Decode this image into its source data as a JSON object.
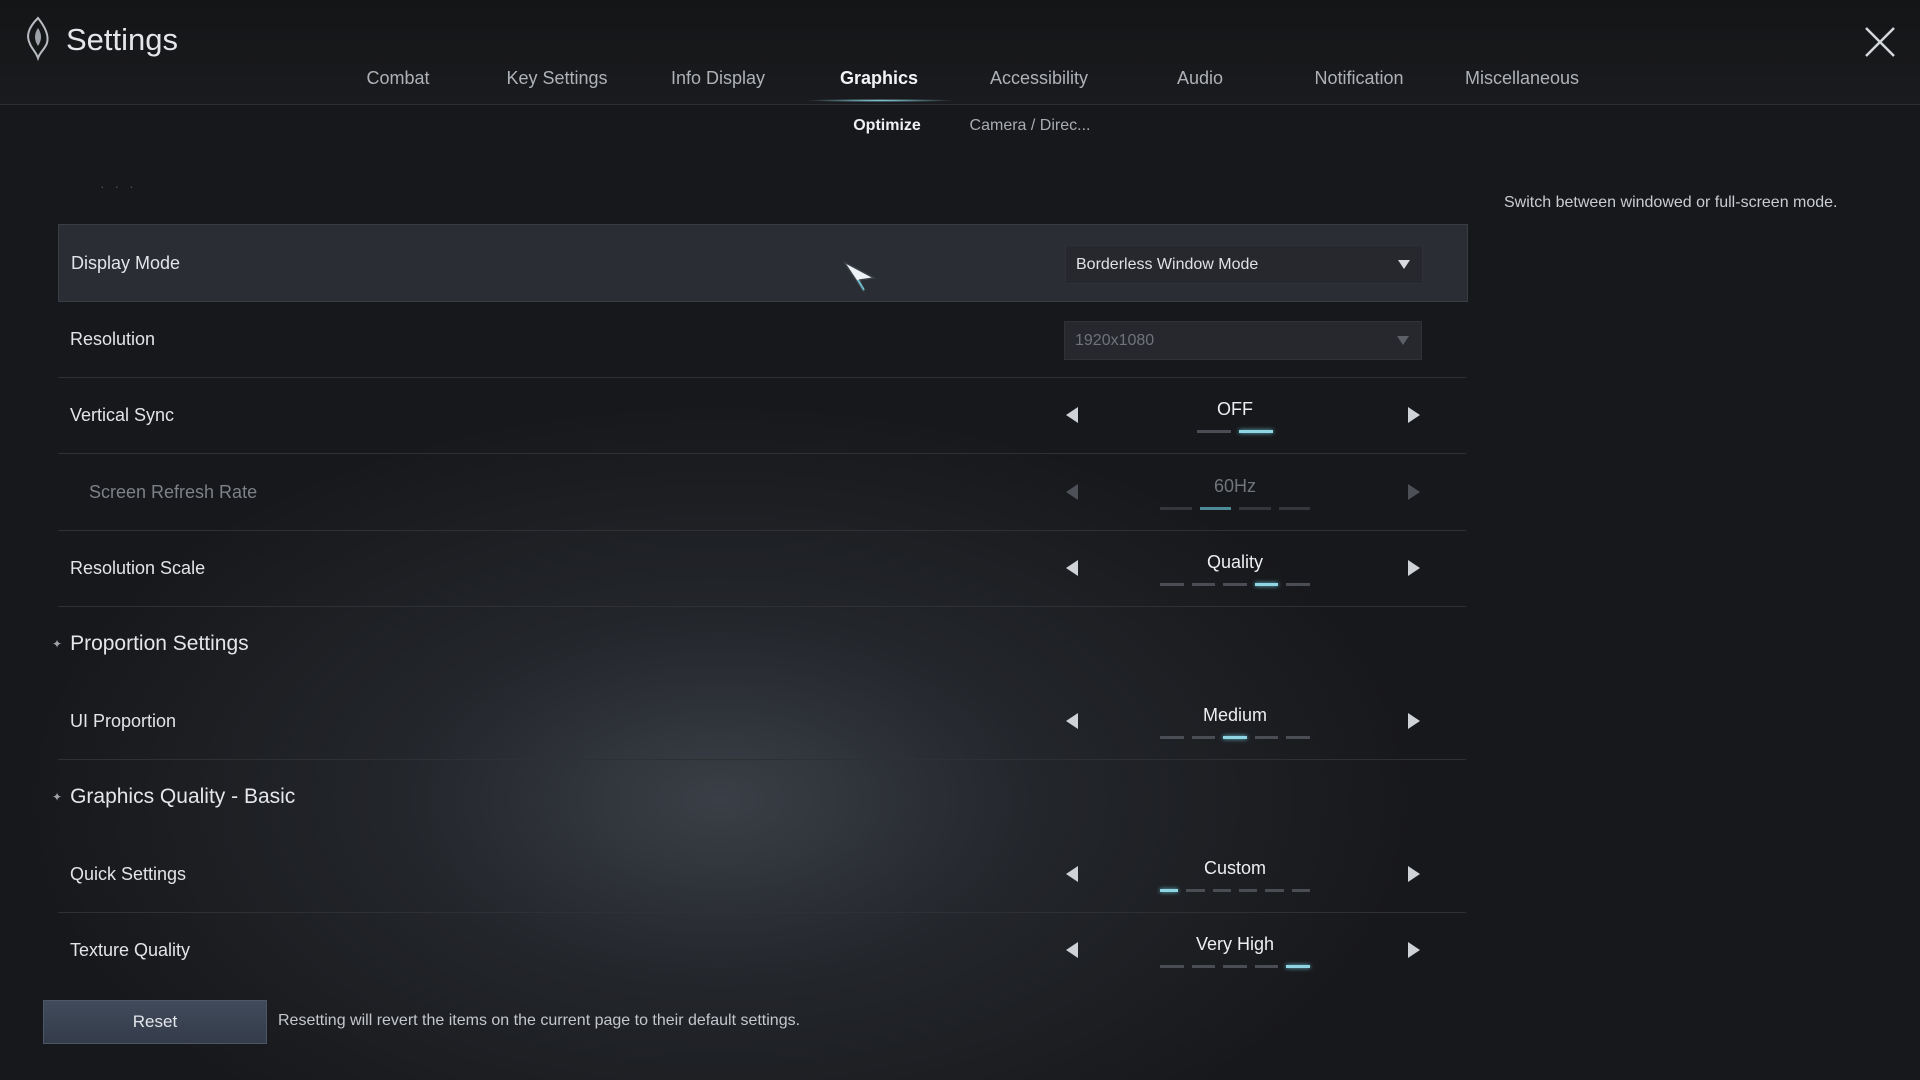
{
  "header": {
    "title": "Settings"
  },
  "tabs": [
    {
      "label": "Combat",
      "active": false
    },
    {
      "label": "Key Settings",
      "active": false
    },
    {
      "label": "Info Display",
      "active": false
    },
    {
      "label": "Graphics",
      "active": true
    },
    {
      "label": "Accessibility",
      "active": false
    },
    {
      "label": "Audio",
      "active": false
    },
    {
      "label": "Notification",
      "active": false
    },
    {
      "label": "Miscellaneous",
      "active": false
    }
  ],
  "subtabs": [
    {
      "label": "Optimize",
      "active": true
    },
    {
      "label": "Camera / Direc...",
      "active": false
    }
  ],
  "description": "Switch between windowed or full-screen mode.",
  "sections": {
    "proportion": "Proportion Settings",
    "graphics_basic": "Graphics Quality - Basic"
  },
  "settings": {
    "display_mode": {
      "label": "Display Mode",
      "value": "Borderless Window Mode"
    },
    "resolution": {
      "label": "Resolution",
      "value": "1920x1080"
    },
    "vertical_sync": {
      "label": "Vertical Sync",
      "value": "OFF",
      "steps": 2,
      "index": 1
    },
    "refresh_rate": {
      "label": "Screen Refresh Rate",
      "value": "60Hz",
      "steps": 4,
      "index": 1
    },
    "resolution_scale": {
      "label": "Resolution Scale",
      "value": "Quality",
      "steps": 5,
      "index": 3
    },
    "ui_proportion": {
      "label": "UI Proportion",
      "value": "Medium",
      "steps": 5,
      "index": 2
    },
    "quick_settings": {
      "label": "Quick Settings",
      "value": "Custom",
      "steps": 6,
      "index": 0
    },
    "texture_quality": {
      "label": "Texture Quality",
      "value": "Very High",
      "steps": 5,
      "index": 4
    }
  },
  "footer": {
    "reset_label": "Reset",
    "reset_note": "Resetting will revert the items on the current page to their default settings."
  },
  "colors": {
    "accent": "#8fd6e4",
    "reset_button": "#3a4352"
  },
  "icons": {
    "logo": "flame-emblem-icon",
    "close": "close-icon",
    "cursor": "pointer-cursor-icon"
  }
}
